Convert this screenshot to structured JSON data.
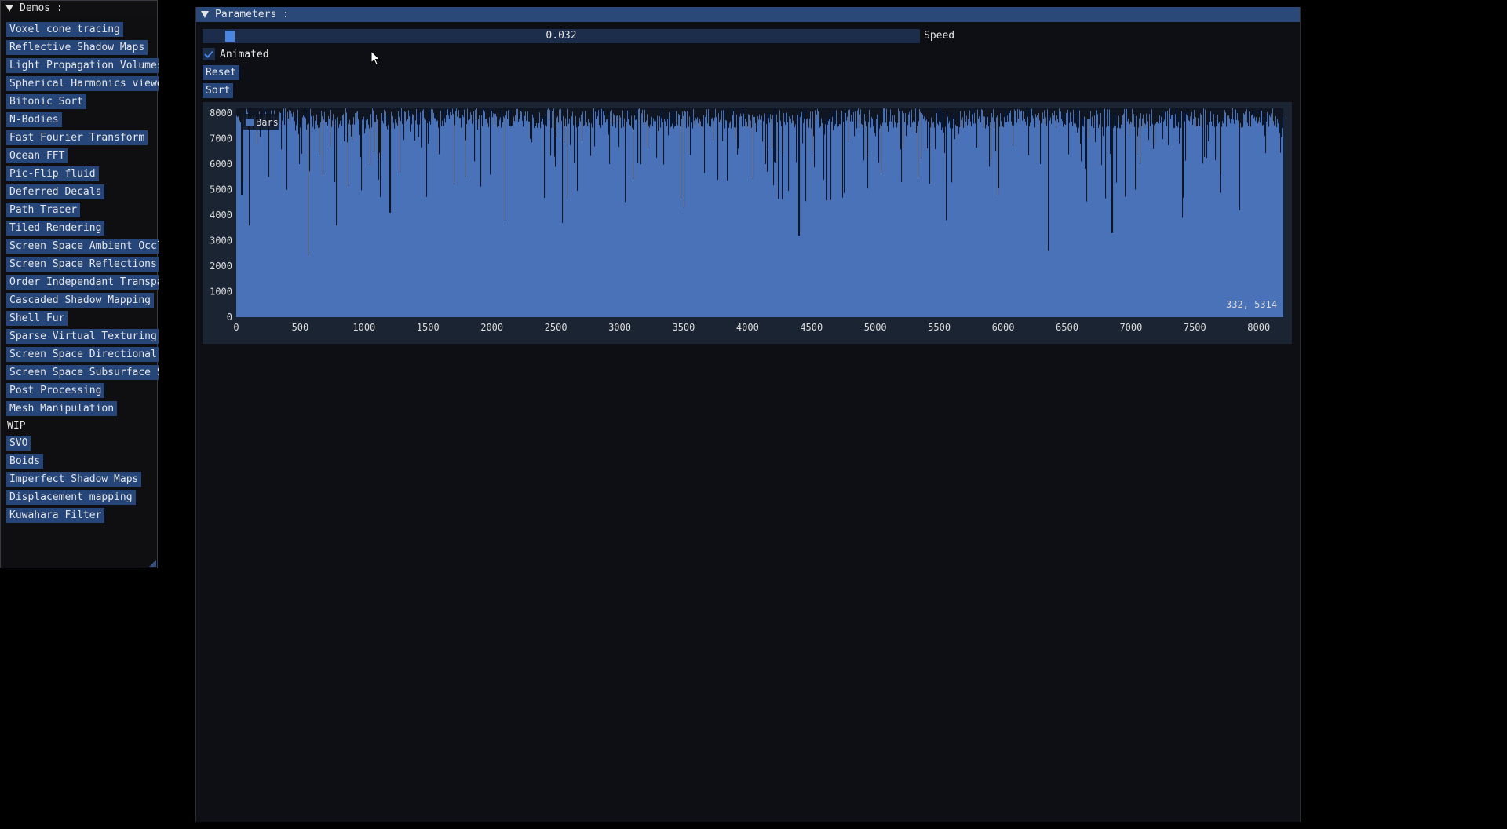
{
  "demos_window": {
    "title": "Demos :",
    "items": [
      "Voxel cone tracing",
      "Reflective Shadow Maps",
      "Light Propagation Volumes",
      "Spherical Harmonics viewer",
      "Bitonic Sort",
      "N-Bodies",
      "Fast Fourier Transform",
      "Ocean FFT",
      "Pic-Flip fluid",
      "Deferred Decals",
      "Path Tracer",
      "Tiled Rendering",
      "Screen Space Ambient Occlus",
      "Screen Space Reflections",
      "Order Independant Transpare",
      "Cascaded Shadow Mapping",
      "Shell Fur",
      "Sparse Virtual Texturing",
      "Screen Space Directional Oc",
      "Screen Space Subsurface Sca",
      "Post Processing",
      "Mesh Manipulation"
    ],
    "wip_label": "WIP",
    "wip_items": [
      "SVO",
      "Boids",
      "Imperfect Shadow Maps",
      "Displacement mapping",
      "Kuwahara Filter"
    ]
  },
  "params_window": {
    "title": "Parameters :",
    "speed": {
      "value": "0.032",
      "label": "Speed",
      "fraction": 0.032
    },
    "animated": {
      "label": "Animated",
      "checked": true
    },
    "reset_label": "Reset",
    "sort_label": "Sort"
  },
  "colors": {
    "accent": "#26467a",
    "title_active": "#2a4878",
    "plot_fill": "#4a72b8",
    "plot_bg": "#1a2433",
    "slider_grab": "#4a86e0"
  },
  "chart_data": {
    "type": "bar",
    "legend": [
      "Bars"
    ],
    "legend_position": "top-left",
    "hover_readout": "332, 5314",
    "xlim": [
      0,
      8192
    ],
    "ylim": [
      0,
      8192
    ],
    "x_ticks": [
      "0",
      "500",
      "1000",
      "1500",
      "2000",
      "2500",
      "3000",
      "3500",
      "4000",
      "4500",
      "5000",
      "5500",
      "6000",
      "6500",
      "7000",
      "7500",
      "8000"
    ],
    "y_ticks": [
      "0",
      "1000",
      "2000",
      "3000",
      "4000",
      "5000",
      "6000",
      "7000",
      "8000"
    ],
    "series": [
      {
        "name": "Bars",
        "count": 8192,
        "sample_x": [
          0,
          40,
          100,
          250,
          500,
          560,
          780,
          1000,
          1200,
          1500,
          1700,
          2100,
          2300,
          2550,
          2800,
          3100,
          3300,
          3500,
          3800,
          4150,
          4400,
          4500,
          4650,
          5000,
          5200,
          5550,
          5900,
          6350,
          6600,
          6850,
          7050,
          7400,
          7700,
          7850,
          8150
        ],
        "sample_y": [
          7900,
          4800,
          3600,
          5500,
          7600,
          2400,
          3600,
          7200,
          4100,
          6800,
          5200,
          3800,
          7000,
          3700,
          6700,
          5400,
          7300,
          4300,
          6900,
          5700,
          3200,
          6500,
          4600,
          7100,
          5300,
          3800,
          6200,
          2600,
          6800,
          3300,
          7100,
          3900,
          5600,
          4200,
          7600
        ],
        "notes_omitted": []
      }
    ]
  }
}
